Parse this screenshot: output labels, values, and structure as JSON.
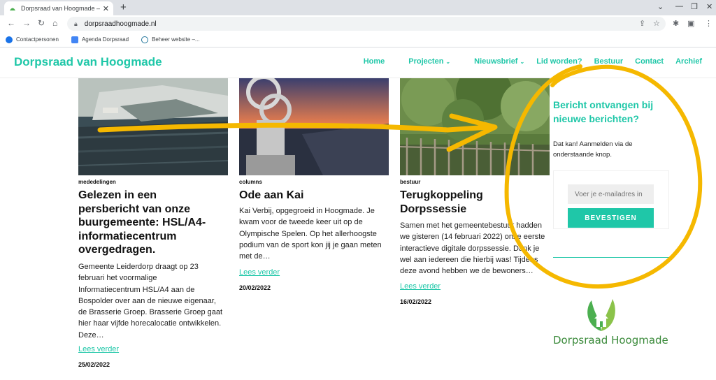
{
  "browser": {
    "tab_title": "Dorpsraad van Hoogmade – Wel",
    "url": "dorpsraadhoogmade.nl",
    "bookmarks": [
      "Contactpersonen",
      "Agenda Dorpsraad",
      "Beheer website –..."
    ]
  },
  "site": {
    "logo": "Dorpsraad van Hoogmade",
    "menu": {
      "home": "Home",
      "projecten": "Projecten",
      "nieuwsbrief": "Nieuwsbrief",
      "lid": "Lid worden?",
      "bestuur": "Bestuur",
      "contact": "Contact",
      "archief": "Archief"
    }
  },
  "cards": [
    {
      "category": "mededelingen",
      "title": [
        "Gelezen in een",
        "persbericht van onze",
        "buurgemeente: HSL/A4-",
        "informatiecentrum",
        "overgedragen."
      ],
      "excerpt": [
        "Gemeente Leiderdorp draagt op 23",
        "februari het voormalige",
        "Informatiecentrum HSL/A4 aan de",
        "Bospolder over aan de nieuwe eigenaar,",
        "de Brasserie Groep. Brasserie Groep gaat",
        "hier haar vijfde horecalocatie ontwikkelen.",
        "Deze…"
      ],
      "more": "Lees verder",
      "date": "25/02/2022"
    },
    {
      "category": "columns",
      "title": [
        "Ode aan Kai"
      ],
      "excerpt": [
        "Kai Verbij, opgegroeid in Hoogmade. Je",
        "kwam voor de tweede keer uit op de",
        "Olympische Spelen. Op het allerhoogste",
        "podium van de sport kon jij je gaan meten",
        "met de…"
      ],
      "more": "Lees verder",
      "date": "20/02/2022"
    },
    {
      "category": "bestuur",
      "title": [
        "Terugkoppeling",
        "Dorpssessie"
      ],
      "excerpt": [
        "Samen met het gemeentebestuur hadden",
        "we gisteren (14 februari 2022) onze eerste",
        "interactieve digitale dorpssessie. Dank je",
        "wel aan iedereen die hierbij was! Tijdens",
        "deze avond hebben we de bewoners…"
      ],
      "more": "Lees verder",
      "date": "16/02/2022"
    }
  ],
  "sidebar": {
    "title": [
      "Bericht ontvangen bij",
      "nieuwe berichten?"
    ],
    "text": [
      "Dat kan! Aanmelden via de",
      "onderstaande knop."
    ],
    "email_placeholder": "Voer je e-mailadres in",
    "button": "BEVESTIGEN",
    "logo_text": "Dorpsraad Hoogmade"
  },
  "colors": {
    "accent": "#1fc7a8",
    "annotation": "#f5b800"
  }
}
